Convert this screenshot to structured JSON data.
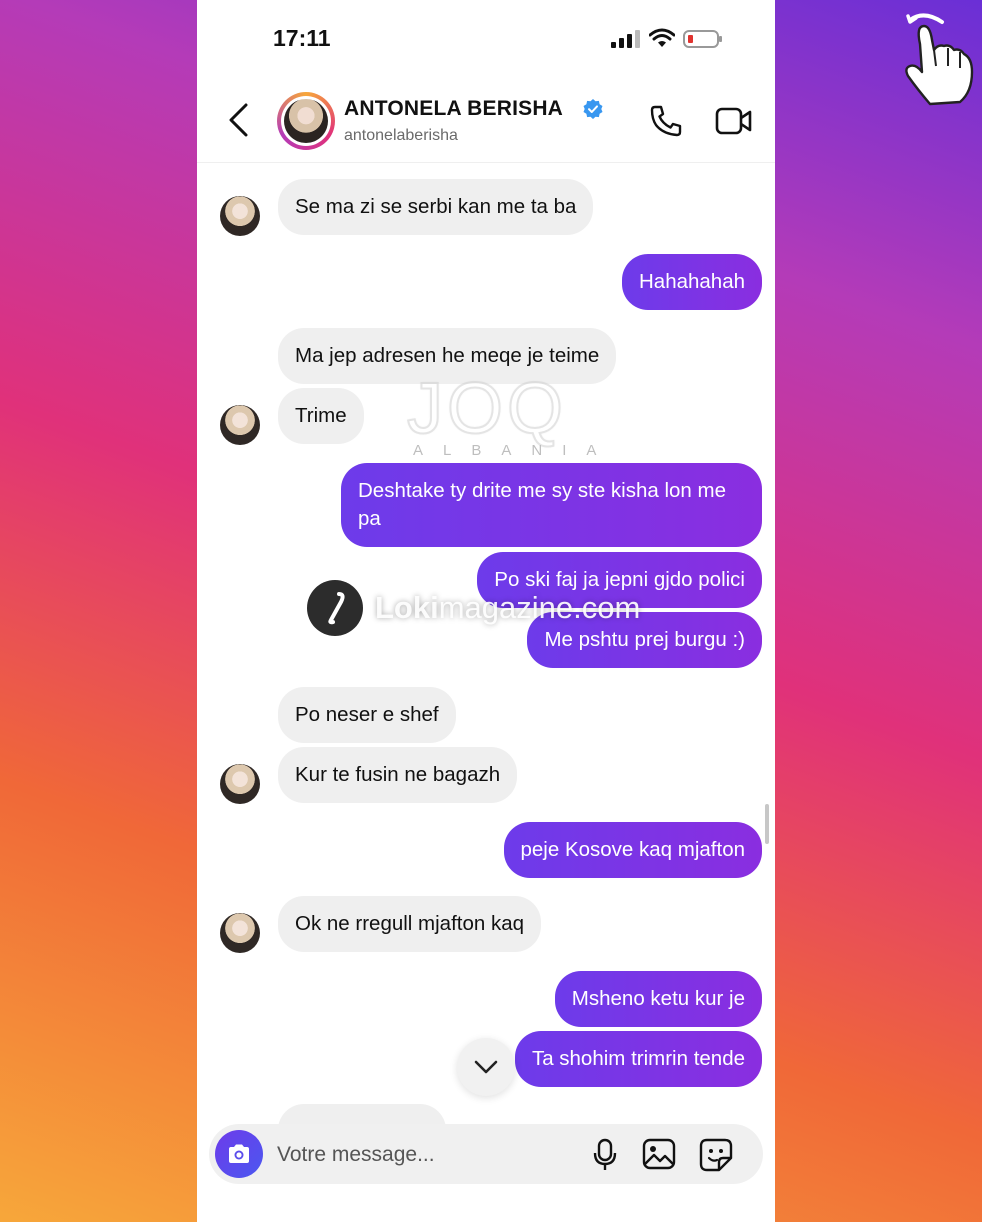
{
  "status_bar": {
    "time": "17:11"
  },
  "header": {
    "name": "ANTONELA BERISHA",
    "username": "antonelaberisha"
  },
  "messages": [
    {
      "from": "them",
      "text": "Se ma zi se serbi kan me ta ba"
    },
    {
      "from": "me",
      "text": "Hahahahah"
    },
    {
      "from": "them",
      "text": "Ma jep adresen he meqe je teime"
    },
    {
      "from": "them",
      "text": "Trime"
    },
    {
      "from": "me",
      "text": "Deshtake ty drite me sy ste kisha lon me pa"
    },
    {
      "from": "me",
      "text": "Po ski faj ja jepni gjdo polici"
    },
    {
      "from": "me",
      "text": "Me pshtu prej burgu :)"
    },
    {
      "from": "them",
      "text": "Po neser e shef"
    },
    {
      "from": "them",
      "text": "Kur te fusin ne bagazh"
    },
    {
      "from": "me",
      "text": "peje Kosove kaq mjafton"
    },
    {
      "from": "them",
      "text": "Ok ne rregull mjafton kaq"
    },
    {
      "from": "me",
      "text": "Msheno ketu kur je"
    },
    {
      "from": "me",
      "text": "Ta shohim trimrin tende"
    }
  ],
  "composer": {
    "placeholder": "Votre message..."
  },
  "watermarks": {
    "joq_word": "JOQ",
    "joq_sub": "ALBANIA",
    "loki_bold": "Loki",
    "loki_rest": "magazine.com"
  },
  "colors": {
    "outgoing": "#7a35e6",
    "incoming": "#efefef",
    "verified": "#3897f0"
  }
}
